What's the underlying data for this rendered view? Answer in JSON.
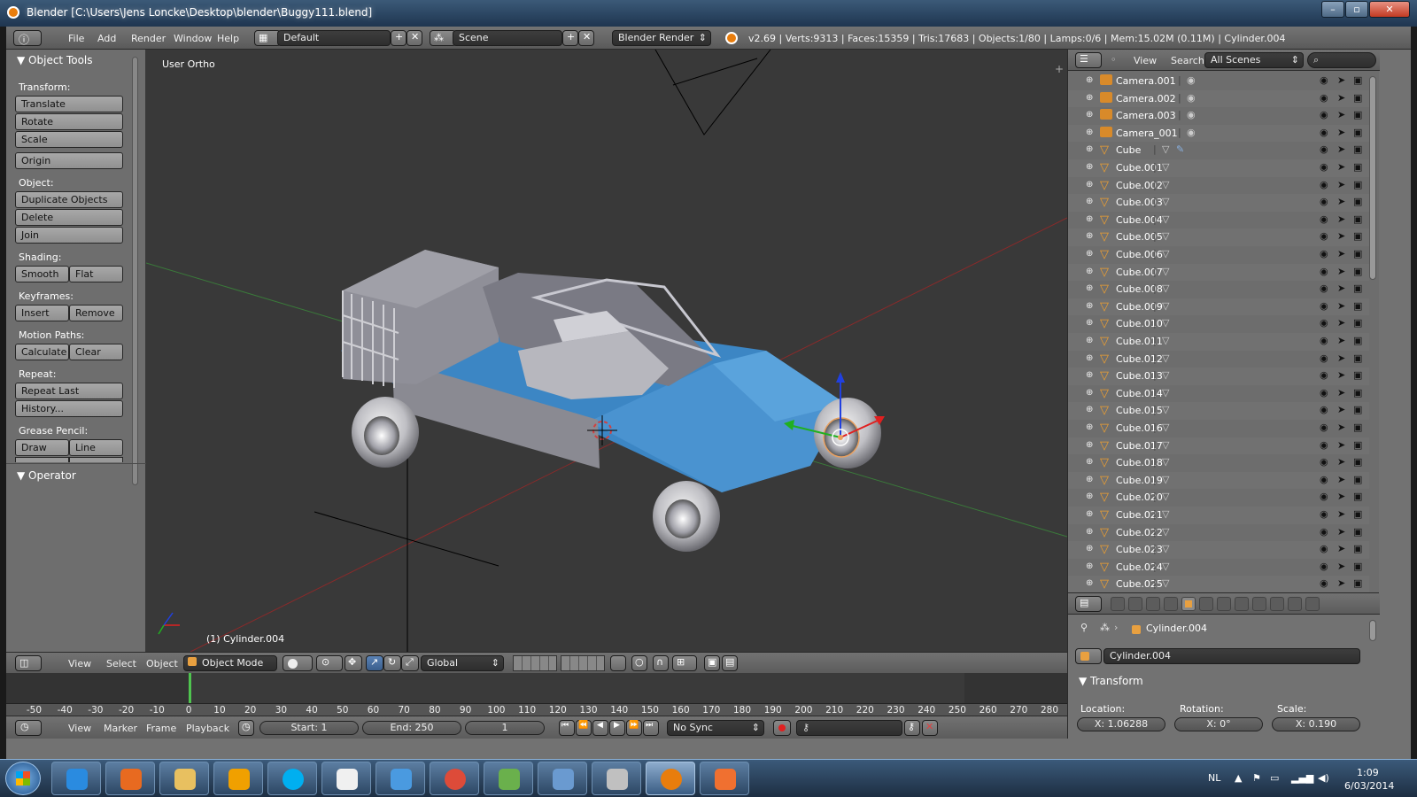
{
  "window": {
    "title": "Blender [C:\\Users\\Jens Loncke\\Desktop\\blender\\Buggy111.blend]",
    "controls": [
      "minimize-icon",
      "maximize-icon",
      "close-icon"
    ]
  },
  "infobar": {
    "menus": [
      "File",
      "Add",
      "Render",
      "Window",
      "Help"
    ],
    "layout": "Default",
    "scene": "Scene",
    "engine": "Blender Render",
    "stats": "v2.69 | Verts:9313 | Faces:15359 | Tris:17683 | Objects:1/80 | Lamps:0/6 | Mem:15.02M (0.11M) | Cylinder.004"
  },
  "toolshelf": {
    "title": "Object Tools",
    "transform_label": "Transform:",
    "translate": "Translate",
    "rotate": "Rotate",
    "scale": "Scale",
    "origin": "Origin",
    "object_label": "Object:",
    "duplicate": "Duplicate Objects",
    "delete": "Delete",
    "join": "Join",
    "shading_label": "Shading:",
    "smooth": "Smooth",
    "flat": "Flat",
    "keyframes_label": "Keyframes:",
    "insert": "Insert",
    "remove": "Remove",
    "motion_label": "Motion Paths:",
    "calculate": "Calculate",
    "clear": "Clear",
    "repeat_label": "Repeat:",
    "repeat_last": "Repeat Last",
    "history": "History...",
    "grease_label": "Grease Pencil:",
    "draw": "Draw",
    "line": "Line",
    "operator": "Operator"
  },
  "viewport": {
    "view_label": "User Ortho",
    "object_label": "(1) Cylinder.004"
  },
  "viewheader": {
    "menus": [
      "View",
      "Select",
      "Object"
    ],
    "mode": "Object Mode",
    "orientation": "Global"
  },
  "timeline": {
    "ticks": [
      "-50",
      "-40",
      "-30",
      "-20",
      "-10",
      "0",
      "10",
      "20",
      "30",
      "40",
      "50",
      "60",
      "70",
      "80",
      "90",
      "100",
      "110",
      "120",
      "130",
      "140",
      "150",
      "160",
      "170",
      "180",
      "190",
      "200",
      "210",
      "220",
      "230",
      "240",
      "250",
      "260",
      "270",
      "280"
    ],
    "current_frame_marker": 0,
    "menus": [
      "View",
      "Marker",
      "Frame",
      "Playback"
    ],
    "start": "Start: 1",
    "end": "End: 250",
    "frame": "1",
    "sync": "No Sync"
  },
  "outliner": {
    "menus": [
      "View",
      "Search"
    ],
    "filter": "All Scenes",
    "items": [
      {
        "name": "Camera.001",
        "kind": "camera"
      },
      {
        "name": "Camera.002",
        "kind": "camera"
      },
      {
        "name": "Camera.003",
        "kind": "camera"
      },
      {
        "name": "Camera_001",
        "kind": "camera"
      },
      {
        "name": "Cube",
        "kind": "mesh"
      },
      {
        "name": "Cube.001",
        "kind": "mesh"
      },
      {
        "name": "Cube.002",
        "kind": "mesh"
      },
      {
        "name": "Cube.003",
        "kind": "mesh"
      },
      {
        "name": "Cube.004",
        "kind": "mesh"
      },
      {
        "name": "Cube.005",
        "kind": "mesh"
      },
      {
        "name": "Cube.006",
        "kind": "mesh"
      },
      {
        "name": "Cube.007",
        "kind": "mesh"
      },
      {
        "name": "Cube.008",
        "kind": "mesh"
      },
      {
        "name": "Cube.009",
        "kind": "mesh"
      },
      {
        "name": "Cube.010",
        "kind": "mesh"
      },
      {
        "name": "Cube.011",
        "kind": "mesh"
      },
      {
        "name": "Cube.012",
        "kind": "mesh"
      },
      {
        "name": "Cube.013",
        "kind": "mesh"
      },
      {
        "name": "Cube.014",
        "kind": "mesh"
      },
      {
        "name": "Cube.015",
        "kind": "mesh"
      },
      {
        "name": "Cube.016",
        "kind": "mesh"
      },
      {
        "name": "Cube.017",
        "kind": "mesh"
      },
      {
        "name": "Cube.018",
        "kind": "mesh"
      },
      {
        "name": "Cube.019",
        "kind": "mesh"
      },
      {
        "name": "Cube.020",
        "kind": "mesh"
      },
      {
        "name": "Cube.021",
        "kind": "mesh"
      },
      {
        "name": "Cube.022",
        "kind": "mesh"
      },
      {
        "name": "Cube.023",
        "kind": "mesh"
      },
      {
        "name": "Cube.024",
        "kind": "mesh"
      },
      {
        "name": "Cube.025",
        "kind": "mesh"
      }
    ]
  },
  "properties": {
    "breadcrumb": "Cylinder.004",
    "object_name": "Cylinder.004",
    "transform": "Transform",
    "location_label": "Location:",
    "rotation_label": "Rotation:",
    "scale_label": "Scale:",
    "loc_x": "X: 1.06288",
    "rot_x": "X: 0°",
    "scale_x": "X: 0.190"
  },
  "taskbar": {
    "language": "NL",
    "time": "1:09",
    "date": "6/03/2014",
    "apps": [
      "windows-start-icon",
      "internet-explorer-icon",
      "media-player-icon",
      "file-explorer-icon",
      "v-app-icon",
      "skype-icon",
      "document-icon",
      "network-globe-icon",
      "chrome-icon",
      "chart-app-icon",
      "photo-viewer-icon",
      "paint-icon",
      "blender-icon",
      "orange-app-icon"
    ]
  },
  "colors": {
    "blender_accent": "#e87d0d",
    "car_body": "#3c86c4",
    "car_panels": "#7d7d85",
    "viewport_bg": "#393939"
  }
}
